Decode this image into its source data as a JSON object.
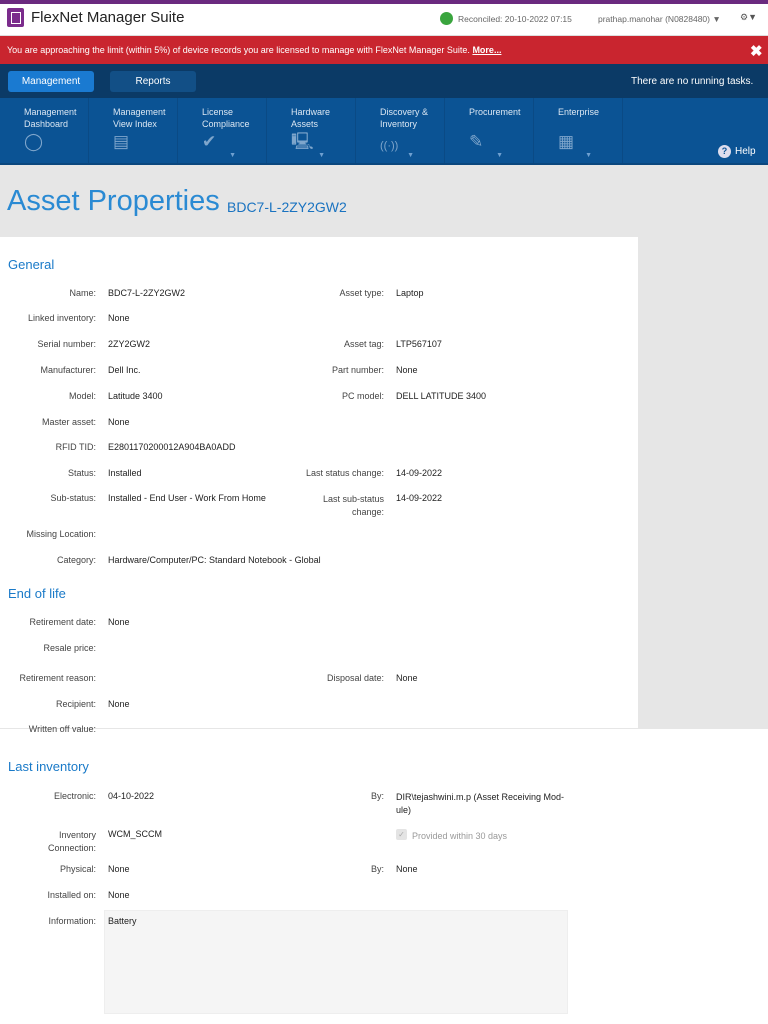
{
  "header": {
    "app_name": "FlexNet Manager Suite",
    "reconciled": "Reconciled: 20-10-2022 07:15",
    "user": "prathap.manohar (N0828480) ▼",
    "settings": "⚙▼"
  },
  "banner": {
    "text": "You are approaching the limit (within 5%) of device records you are licensed to manage with FlexNet Manager Suite.",
    "link": "More...",
    "close": "✖"
  },
  "tabs": {
    "management": "Management",
    "reports": "Reports",
    "tasks": "There are no running tasks."
  },
  "nav": [
    {
      "l1": "Management",
      "l2": "Dashboard",
      "icon": "◯"
    },
    {
      "l1": "Management",
      "l2": "View Index",
      "icon": "▤"
    },
    {
      "l1": "License",
      "l2": "Compliance",
      "icon": "✔"
    },
    {
      "l1": "Hardware",
      "l2": "Assets",
      "icon": "🖳"
    },
    {
      "l1": "Discovery &",
      "l2": "Inventory",
      "icon": "((·))"
    },
    {
      "l1": "Procurement",
      "l2": "",
      "icon": "✎"
    },
    {
      "l1": "Enterprise",
      "l2": "",
      "icon": "▦"
    }
  ],
  "help": "Help",
  "page": {
    "title": "Asset Properties",
    "subtitle": "BDC7-L-2ZY2GW2"
  },
  "general": {
    "title": "General",
    "name_l": "Name:",
    "name": "BDC7-L-2ZY2GW2",
    "type_l": "Asset type:",
    "type": "Laptop",
    "linked_l": "Linked inventory:",
    "linked": "None",
    "serial_l": "Serial number:",
    "serial": "2ZY2GW2",
    "tag_l": "Asset tag:",
    "tag": "LTP567107",
    "mfr_l": "Manufacturer:",
    "mfr": "Dell Inc.",
    "part_l": "Part number:",
    "part": "None",
    "model_l": "Model:",
    "model": "Latitude 3400",
    "pc_l": "PC model:",
    "pc": "DELL LATITUDE 3400",
    "master_l": "Master asset:",
    "master": "None",
    "rfid_l": "RFID TID:",
    "rfid": "E2801170200012A904BA0ADD",
    "status_l": "Status:",
    "status": "Installed",
    "lsc_l": "Last status change:",
    "lsc": "14-09-2022",
    "sub_l": "Sub-status:",
    "sub": "Installed - End User - Work From Home",
    "lssc_l1": "Last sub-status",
    "lssc_l2": "change:",
    "lssc": "14-09-2022",
    "missing_l": "Missing Location:",
    "cat_l": "Category:",
    "cat": "Hardware/Computer/PC: Standard Notebook - Global"
  },
  "eol": {
    "title": "End of life",
    "ret_l": "Retirement date:",
    "ret": "None",
    "resale_l": "Resale price:",
    "reason_l": "Retirement reason:",
    "disp_l": "Disposal date:",
    "disp": "None",
    "recip_l": "Recipient:",
    "recip": "None",
    "wo_l": "Written off value:"
  },
  "inv": {
    "title": "Last inventory",
    "elec_l": "Electronic:",
    "elec": "04-10-2022",
    "by_l": "By:",
    "by1": "DIR\\tejashwini.m.p (Asset Receiving Mod-",
    "by2": "ule)",
    "conn_l1": "Inventory",
    "conn_l2": "Connection:",
    "conn": "WCM_SCCM",
    "provided": "Provided within 30 days",
    "phys_l": "Physical:",
    "phys": "None",
    "by2_l": "By:",
    "by2v": "None",
    "inst_l": "Installed on:",
    "inst": "None",
    "info_l": "Information:",
    "info": "Battery"
  }
}
